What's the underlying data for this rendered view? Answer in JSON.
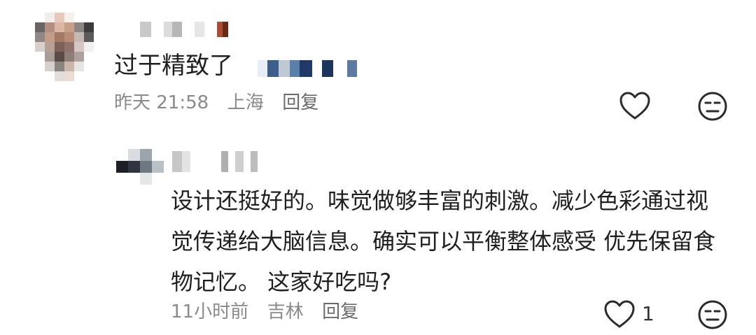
{
  "comment": {
    "text": "过于精致了",
    "time": "昨天 21:58",
    "location": "上海",
    "reply_label": "回复",
    "like_icon": "heart-outline-icon",
    "dislike_icon": "neutral-face-icon"
  },
  "reply": {
    "text": "设计还挺好的。味觉做够丰富的刺激。减少色彩通过视觉传递给大脑信息。确实可以平衡整体感受 优先保留食物记忆。 这家好吃吗?",
    "time": "11小时前",
    "location": "吉林",
    "reply_label": "回复",
    "like_count": "1",
    "like_icon": "heart-outline-icon",
    "dislike_icon": "neutral-face-icon"
  },
  "colors": {
    "text": "#1f1f1f",
    "meta": "#8a8a8a",
    "icon": "#2b2b2b"
  }
}
